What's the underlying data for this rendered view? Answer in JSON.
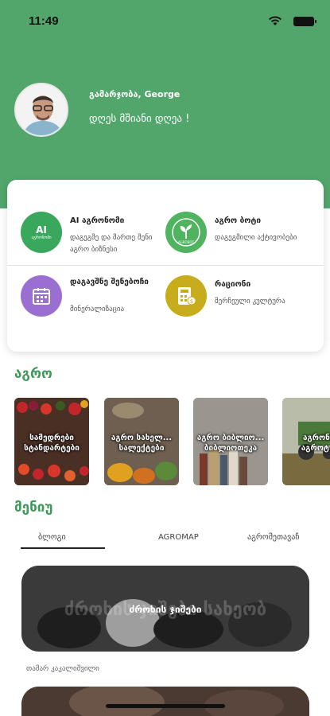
{
  "status_bar": {
    "time": "11:49"
  },
  "header": {
    "greeting": "გამარჯობა, George",
    "subtitle": "დღეს მშიანი დღეა !",
    "color": "#52a66c"
  },
  "services": [
    {
      "icon_text": "AI",
      "icon_subtext": "აგრონომი",
      "title": "AI აგრონომი",
      "subtitle": "დაგეგმე და მართე შენი აგრო ბიზნესი",
      "color": "#3aa85c"
    },
    {
      "icon_text": "",
      "icon_subtext": "AGROBOT",
      "title": "აგრო ბოტი",
      "subtitle": "დაგეგმილი აქტივობები",
      "color": "#4fb35f"
    },
    {
      "icon_text": "",
      "icon_subtext": "",
      "title": "დაგავშნე შენებოჩი",
      "subtitle": "მინერალიზაცია",
      "color": "#9b6fd1"
    },
    {
      "icon_text": "",
      "icon_subtext": "",
      "title": "რაციონი",
      "subtitle": "შერჩეული კულტურა",
      "color": "#c7ad1c"
    }
  ],
  "sections": {
    "agro": "აგრო",
    "menu": "მენიუ"
  },
  "agro_items": [
    {
      "label": "სამედრები სტანდარტები"
    },
    {
      "label": "აგრო სახელ... სალექტები"
    },
    {
      "label": "აგრო ბიბლიო... ბიბლიოთეკა"
    },
    {
      "label": "აგრონო აგროტ..."
    }
  ],
  "tabs": [
    "ბლოგი",
    "AGROMAP",
    "აგრომეთავაჩ"
  ],
  "blog": {
    "title": "ძროხის ჯიშები",
    "watermark": "ძროხის ჯიშები სახეობ",
    "author": "თამარ კაკალიშვილი"
  }
}
